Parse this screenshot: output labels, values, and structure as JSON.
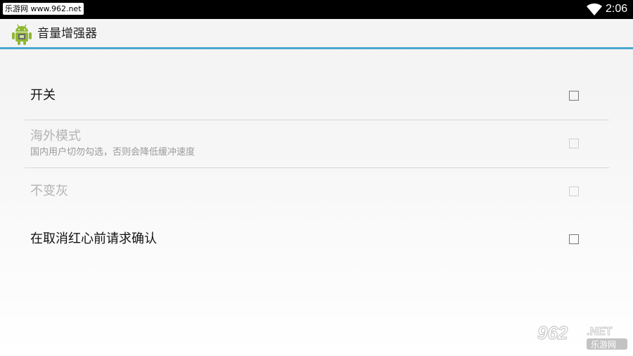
{
  "status_bar": {
    "watermark": "乐游网 www.962.net",
    "time": "2:06",
    "wifi_icon": "wifi-icon"
  },
  "action_bar": {
    "app_icon": "android-app-icon",
    "title": "音量增强器"
  },
  "preferences": [
    {
      "title": "开关",
      "summary": "",
      "checked": false,
      "enabled": true
    },
    {
      "title": "海外模式",
      "summary": "国内用户切勿勾选，否则会降低缓冲速度",
      "checked": false,
      "enabled": false
    },
    {
      "title": "不变灰",
      "summary": "",
      "checked": false,
      "enabled": false
    },
    {
      "title": "在取消红心前请求确认",
      "summary": "",
      "checked": false,
      "enabled": true
    }
  ],
  "watermark_logo": {
    "text_top": "962",
    "text_right": ".NET",
    "text_bottom": "乐游网"
  },
  "colors": {
    "accent_line": "#4aa8cf",
    "android_green": "#8fb833"
  }
}
